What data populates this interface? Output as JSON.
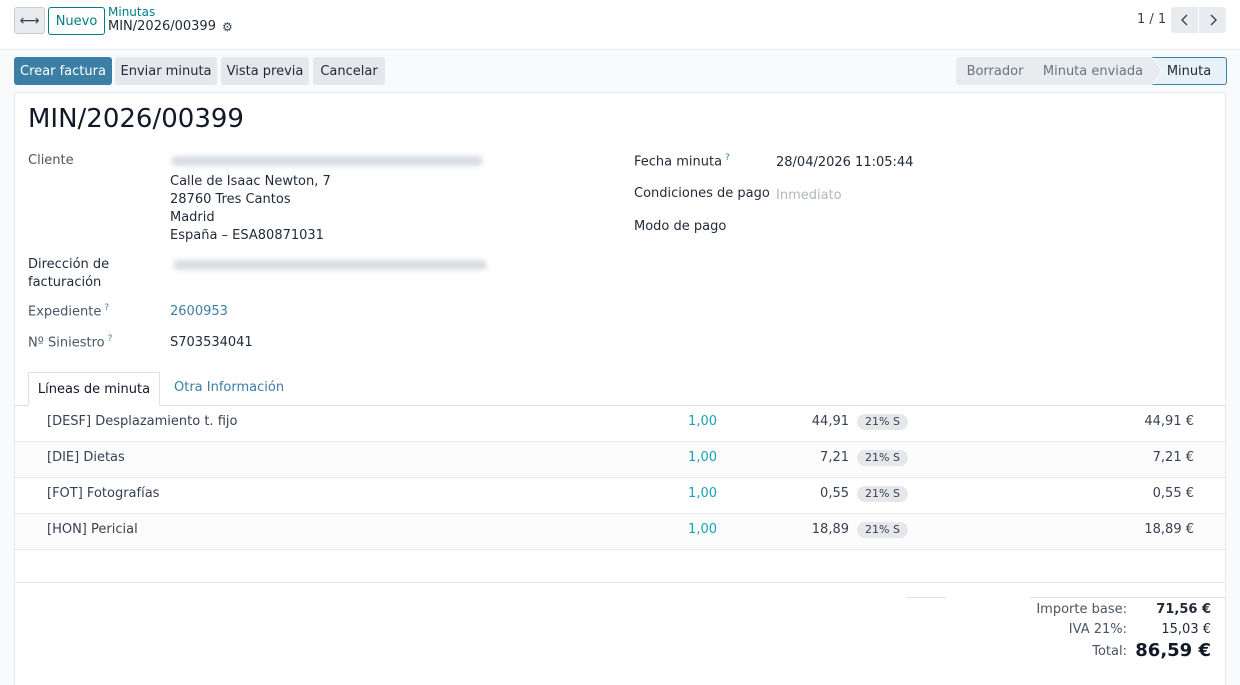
{
  "control_panel": {
    "new_label": "Nuevo",
    "breadcrumb_parent": "Minutas",
    "breadcrumb_current": "MIN/2026/00399",
    "pager": "1 / 1"
  },
  "actions": {
    "create_invoice": "Crear factura",
    "send": "Enviar minuta",
    "preview": "Vista previa",
    "cancel": "Cancelar"
  },
  "status_stages": [
    "Borrador",
    "Minuta enviada",
    "Minuta"
  ],
  "status_active": "Minuta",
  "record": {
    "title": "MIN/2026/00399",
    "cliente_label": "Cliente",
    "cliente_address": [
      "Calle de Isaac Newton, 7",
      "28760 Tres Cantos",
      "Madrid",
      "España – ESA80871031"
    ],
    "billing_label_1": "Dirección de",
    "billing_label_2": "facturación",
    "expediente_label": "Expediente",
    "expediente_value": "2600953",
    "siniestro_label": "Nº Siniestro",
    "siniestro_value": "S703534041",
    "fecha_label": "Fecha minuta",
    "fecha_value": "28/04/2026 11:05:44",
    "condiciones_label": "Condiciones de pago",
    "condiciones_value": "Inmediato",
    "modo_label": "Modo de pago",
    "help_mark": "?"
  },
  "tabs": [
    "Líneas de minuta",
    "Otra Información"
  ],
  "lines": [
    {
      "name": "[DESF] Desplazamiento t. fijo",
      "qty": "1,00",
      "price": "44,91",
      "tax": "21% S",
      "subtotal": "44,91 €"
    },
    {
      "name": "[DIE] Dietas",
      "qty": "1,00",
      "price": "7,21",
      "tax": "21% S",
      "subtotal": "7,21 €"
    },
    {
      "name": "[FOT] Fotografías",
      "qty": "1,00",
      "price": "0,55",
      "tax": "21% S",
      "subtotal": "0,55 €"
    },
    {
      "name": "[HON] Pericial",
      "qty": "1,00",
      "price": "18,89",
      "tax": "21% S",
      "subtotal": "18,89 €"
    }
  ],
  "totals": {
    "base_label": "Importe base:",
    "base_value": "71,56 €",
    "iva_label": "IVA 21%:",
    "iva_value": "15,03 €",
    "total_label": "Total:",
    "total_value": "86,59 €"
  },
  "icons": {
    "expand": "expand-horizontal-icon",
    "gear": "gear-icon",
    "prev": "chevron-left-icon",
    "next": "chevron-right-icon"
  },
  "colors": {
    "primary": "#3b7fa5",
    "link": "#017e84"
  }
}
